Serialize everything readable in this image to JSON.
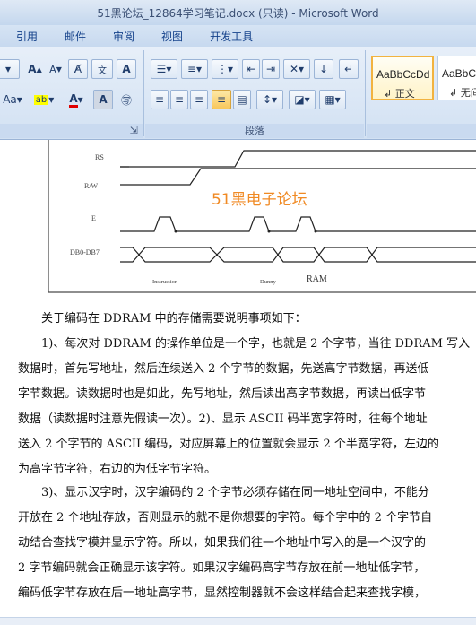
{
  "window": {
    "title": "51黑论坛_12864学习笔记.docx (只读) - Microsoft Word"
  },
  "tabs": [
    "引用",
    "邮件",
    "审阅",
    "视图",
    "开发工具"
  ],
  "ribbon": {
    "font_group": {
      "font_size_label": "Aa",
      "grow": "A",
      "shrink": "A"
    },
    "paragraph_group": {
      "label": "段落"
    },
    "styles": [
      {
        "sample": "AaBbCcDd",
        "name": "↲ 正文"
      },
      {
        "sample": "AaBbC",
        "name": "↲ 无间"
      }
    ],
    "left_group_label": "ς"
  },
  "figure": {
    "signals": [
      "RS",
      "R/W",
      "E",
      "DB0-DB7"
    ],
    "bus_labels": [
      "Instruction",
      "Dunny",
      "RAM"
    ],
    "watermark": "51黑电子论坛"
  },
  "document": {
    "paragraphs": [
      [
        "　　关于编码在 DDRAM 中的存储需要说明事项如下："
      ],
      [
        "　　1)、每次对 DDRAM 的操作单位是一个字，也就是 2 个字节，当往 DDRAM 写入",
        "数据时，首先写地址，然后连续送入 2 个字节的数据，先送高字节数据，再送低",
        "字节数据。读数据时也是如此，先写地址，然后读出高字节数据，再读出低字节",
        "数据（读数据时注意先假读一次）。2)、显示 ASCII 码半宽字符时，往每个地址",
        "送入 2 个字节的 ASCII 编码，对应屏幕上的位置就会显示 2 个半宽字符，左边的",
        "为高字节字符，右边的为低字节字符。"
      ],
      [
        "　　3)、显示汉字时，汉字编码的 2 个字节必须存储在同一地址空间中，不能分",
        "开放在 2 个地址存放，否则显示的就不是你想要的字符。每个字中的 2 个字节自",
        "动结合查找字模并显示字符。所以，如果我们往一个地址中写入的是一个汉字的",
        "2 字节编码就会正确显示该字符。如果汉字编码高字节存放在前一地址低字节，",
        "编码低字节存放在后一地址高字节，显然控制器就不会这样结合起来查找字模，"
      ]
    ]
  }
}
